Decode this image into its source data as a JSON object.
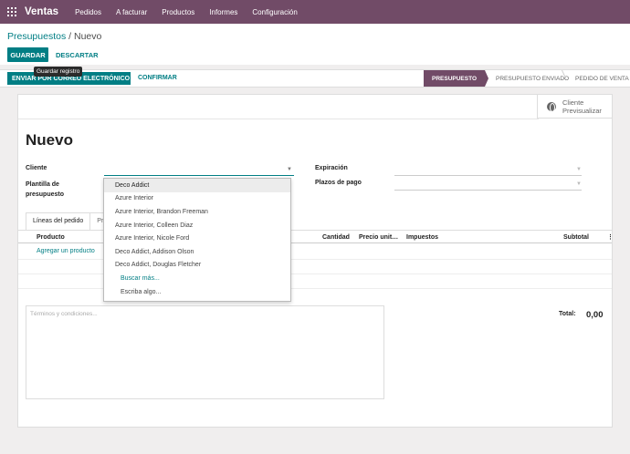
{
  "nav": {
    "app_name": "Ventas",
    "menu": [
      "Pedidos",
      "A facturar",
      "Productos",
      "Informes",
      "Configuración"
    ]
  },
  "breadcrumb": {
    "parent": "Presupuestos",
    "separator": " / ",
    "current": "Nuevo"
  },
  "actions": {
    "save": "GUARDAR",
    "discard": "DESCARTAR",
    "save_tooltip": "Guardar registro"
  },
  "statusbar": {
    "send_email": "ENVIAR POR CORREO ELECTRÓNICO",
    "confirm": "CONFIRMAR",
    "stages": [
      "PRESUPUESTO",
      "PRESUPUESTO ENVIADO",
      "PEDIDO DE VENTA"
    ],
    "active_stage": "PRESUPUESTO"
  },
  "sheet": {
    "preview_label": "Cliente Previsualizar",
    "title": "Nuevo",
    "fields": {
      "customer": "Cliente",
      "template": "Plantilla de presupuesto",
      "expiration": "Expiración",
      "payment_terms": "Plazos de pago"
    },
    "tabs": [
      "Líneas del pedido",
      "Pr"
    ],
    "columns": [
      "Producto",
      "Cantidad",
      "Precio unit…",
      "Impuestos",
      "Subtotal"
    ],
    "add_product": "Agregar un producto",
    "terms_placeholder": "Términos y condiciones...",
    "total_label": "Total:",
    "total_value": "0,00"
  },
  "dropdown": {
    "options": [
      "Deco Addict",
      "Azure Interior",
      "Azure Interior, Brandon Freeman",
      "Azure Interior, Colleen Diaz",
      "Azure Interior, Nicole Ford",
      "Deco Addict, Addison Olson",
      "Deco Addict, Douglas Fletcher"
    ],
    "search_more": "Buscar más...",
    "create_hint": "Escriba algo..."
  },
  "colors": {
    "brand": "#714b67",
    "primary": "#017e84"
  }
}
